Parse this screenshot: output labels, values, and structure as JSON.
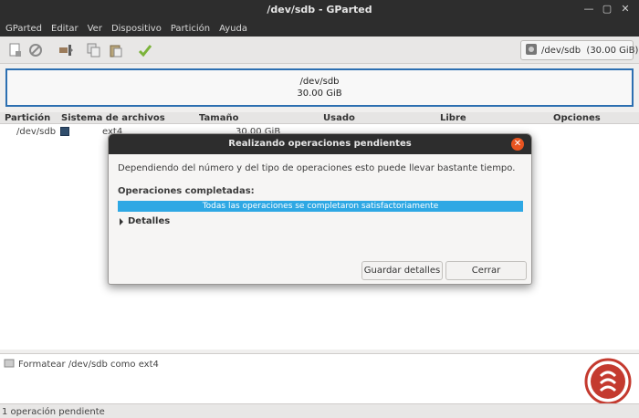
{
  "window": {
    "title": "/dev/sdb - GParted"
  },
  "menu": [
    "GParted",
    "Editar",
    "Ver",
    "Dispositivo",
    "Partición",
    "Ayuda"
  ],
  "toolbar": {
    "icons": [
      "new-icon",
      "delete-icon",
      "resize-icon",
      "copy-icon",
      "paste-icon",
      "apply-icon"
    ],
    "device": "/dev/sdb  (30.00 GiB)"
  },
  "partition_map": {
    "device": "/dev/sdb",
    "size": "30.00 GiB"
  },
  "table": {
    "columns": [
      "Partición",
      "Sistema de archivos",
      "Tamaño",
      "Usado",
      "Libre",
      "Opciones"
    ],
    "rows": [
      {
        "partition": "/dev/sdb",
        "filesystem": "ext4",
        "size": "30.00 GiB",
        "fs_color": "#314e6c"
      }
    ]
  },
  "pending": {
    "operation": "Formatear /dev/sdb como ext4"
  },
  "status": {
    "text": "1 operación pendiente"
  },
  "dialog": {
    "title": "Realizando operaciones pendientes",
    "description": "Dependiendo del número y del tipo de operaciones esto puede llevar bastante tiempo.",
    "completed_label": "Operaciones completadas:",
    "progress_text": "Todas las operaciones se completaron satisfactoriamente",
    "progress_percent": 100,
    "details_label": "Detalles",
    "save_button": "Guardar detalles",
    "close_button": "Cerrar"
  },
  "colors": {
    "accent": "#2ea8e4",
    "close": "#e95420",
    "selection_border": "#2c6fb1"
  }
}
